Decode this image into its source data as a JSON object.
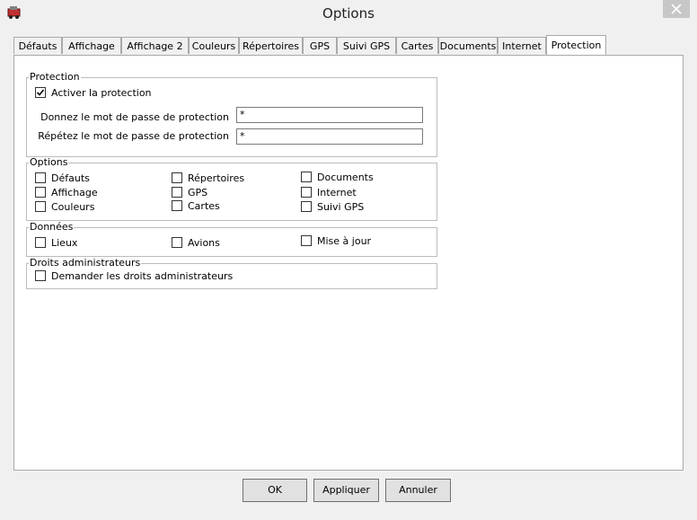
{
  "window": {
    "title": "Options"
  },
  "tabs": [
    {
      "label": "Défauts"
    },
    {
      "label": "Affichage"
    },
    {
      "label": "Affichage 2"
    },
    {
      "label": "Couleurs"
    },
    {
      "label": "Répertoires"
    },
    {
      "label": "GPS"
    },
    {
      "label": "Suivi GPS"
    },
    {
      "label": "Cartes"
    },
    {
      "label": "Documents"
    },
    {
      "label": "Internet"
    },
    {
      "label": "Protection"
    }
  ],
  "protection": {
    "legend": "Protection",
    "activate_label": "Activer la protection",
    "activate_checked": true,
    "password_label": "Donnez le mot de passe de protection",
    "password_value": "*",
    "repeat_label": "Répétez le mot de passe de protection",
    "repeat_value": "*"
  },
  "options": {
    "legend": "Options",
    "items": [
      {
        "label": "Défauts",
        "checked": false
      },
      {
        "label": "Affichage",
        "checked": false
      },
      {
        "label": "Couleurs",
        "checked": false
      },
      {
        "label": "Répertoires",
        "checked": false
      },
      {
        "label": "GPS",
        "checked": false
      },
      {
        "label": "Cartes",
        "checked": false
      },
      {
        "label": "Documents",
        "checked": false
      },
      {
        "label": "Internet",
        "checked": false
      },
      {
        "label": "Suivi GPS",
        "checked": false
      }
    ]
  },
  "donnees": {
    "legend": "Données",
    "items": [
      {
        "label": "Lieux",
        "checked": false
      },
      {
        "label": "Avions",
        "checked": false
      },
      {
        "label": "Mise à  jour",
        "checked": false
      }
    ]
  },
  "admin": {
    "legend": "Droits administrateurs",
    "label": "Demander les droits administrateurs",
    "checked": false
  },
  "buttons": {
    "ok": "OK",
    "apply": "Appliquer",
    "cancel": "Annuler"
  }
}
